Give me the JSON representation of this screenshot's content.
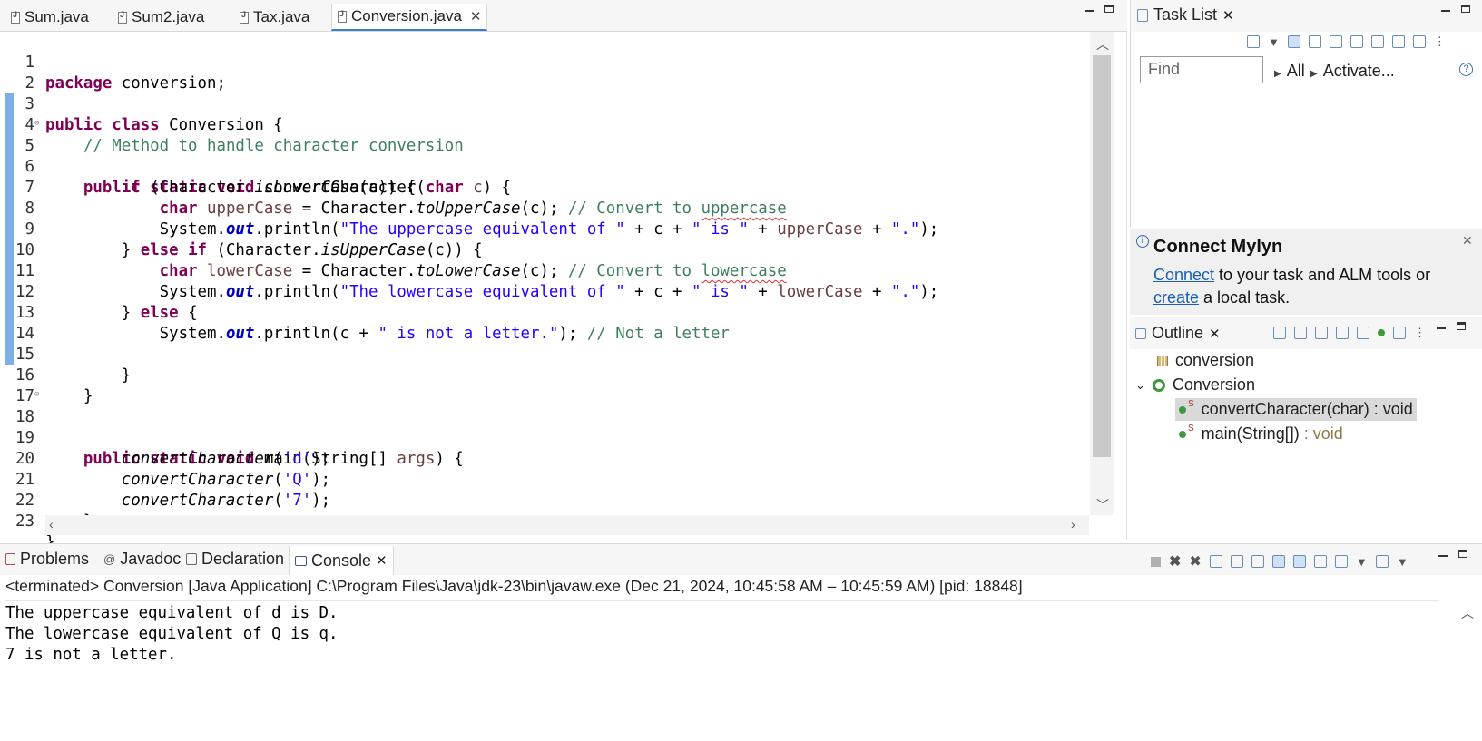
{
  "editor": {
    "tabs": [
      {
        "label": "Sum.java"
      },
      {
        "label": "Sum2.java"
      },
      {
        "label": "Tax.java"
      },
      {
        "label": "Conversion.java",
        "active": true
      }
    ],
    "line_numbers": [
      "1",
      "2",
      "3",
      "4",
      "5",
      "6",
      "7",
      "8",
      "9",
      "10",
      "11",
      "12",
      "13",
      "14",
      "15",
      "16",
      "17",
      "18",
      "19",
      "20",
      "21",
      "22",
      "23"
    ],
    "code": {
      "l1_kw": "package",
      "l1_rest": " conversion;",
      "l3_kw": "public class",
      "l3_rest": " Conversion {",
      "l4_cm": "// Method to handle character conversion",
      "l5_kw": "public static void",
      "l5_a": " convertCharacter(",
      "l5_kw2": "char",
      "l5_var": " c",
      "l5_b": ") {",
      "l6_kw": "if",
      "l6_a": " (Character.",
      "l6_it": "isLowerCase",
      "l6_b": "(c)) {",
      "l7_kw": "char",
      "l7_var": " upperCase",
      "l7_a": " = Character.",
      "l7_it": "toUpperCase",
      "l7_b": "(c); ",
      "l7_cm1": "// Convert to ",
      "l7_cm2": "uppercase",
      "l8_a": "System.",
      "l8_fld": "out",
      "l8_b": ".println(",
      "l8_s1": "\"The uppercase equivalent of \"",
      "l8_c": " + c + ",
      "l8_s2": "\" is \"",
      "l8_d": " + ",
      "l8_var": "upperCase",
      "l8_e": " + ",
      "l8_s3": "\".\"",
      "l8_f": ");",
      "l9_a": "} ",
      "l9_kw": "else if",
      "l9_b": " (Character.",
      "l9_it": "isUpperCase",
      "l9_c": "(c)) {",
      "l10_kw": "char",
      "l10_var": " lowerCase",
      "l10_a": " = Character.",
      "l10_it": "toLowerCase",
      "l10_b": "(c); ",
      "l10_cm1": "// Convert to ",
      "l10_cm2": "lowercase",
      "l11_a": "System.",
      "l11_fld": "out",
      "l11_b": ".println(",
      "l11_s1": "\"The lowercase equivalent of \"",
      "l11_c": " + c + ",
      "l11_s2": "\" is \"",
      "l11_d": " + ",
      "l11_var": "lowerCase",
      "l11_e": " + ",
      "l11_s3": "\".\"",
      "l11_f": ");",
      "l12_a": "} ",
      "l12_kw": "else",
      "l12_b": " {",
      "l13_a": "System.",
      "l13_fld": "out",
      "l13_b": ".println(c + ",
      "l13_s": "\" is not a letter.\"",
      "l13_c": "); ",
      "l13_cm": "// Not a letter",
      "l15": "}",
      "l16": "}",
      "l18_kw": "public static void",
      "l18_a": " main(String[] ",
      "l18_var": "args",
      "l18_b": ") {",
      "l19_it": "convertCharacter",
      "l19_a": "(",
      "l19_s": "'d'",
      "l19_b": ");",
      "l20_it": "convertCharacter",
      "l20_a": "(",
      "l20_s": "'Q'",
      "l20_b": ");",
      "l21_it": "convertCharacter",
      "l21_a": "(",
      "l21_s": "'7'",
      "l21_b": ");",
      "l22": "}",
      "l23": "}"
    }
  },
  "task_list": {
    "title": "Task List",
    "find_placeholder": "Find",
    "filter_all": "All",
    "filter_activate": "Activate...",
    "help": "?"
  },
  "mylyn": {
    "title": "Connect Mylyn",
    "connect_link": "Connect",
    "text1": " to your task and ALM tools or",
    "create_link": "create",
    "text2": " a local task."
  },
  "outline": {
    "title": "Outline",
    "package": "conversion",
    "class": "Conversion",
    "method1": "convertCharacter(char) : void",
    "method2_name": "main(String[])",
    "method2_type": " : void",
    "static_mark": "S"
  },
  "console": {
    "tabs": [
      {
        "label": "Problems"
      },
      {
        "label": "Javadoc"
      },
      {
        "label": "Declaration"
      },
      {
        "label": "Console",
        "active": true
      }
    ],
    "status": "<terminated> Conversion [Java Application] C:\\Program Files\\Java\\jdk-23\\bin\\javaw.exe  (Dec 21, 2024, 10:45:58 AM – 10:45:59 AM) [pid: 18848]",
    "output": "The uppercase equivalent of d is D.\nThe lowercase equivalent of Q is q.\n7 is not a letter."
  },
  "colors": {
    "keyword": "#7f0055",
    "comment": "#3f7f5f",
    "string": "#2a00ff",
    "field": "#0000c0",
    "accent": "#3a7bd5"
  }
}
